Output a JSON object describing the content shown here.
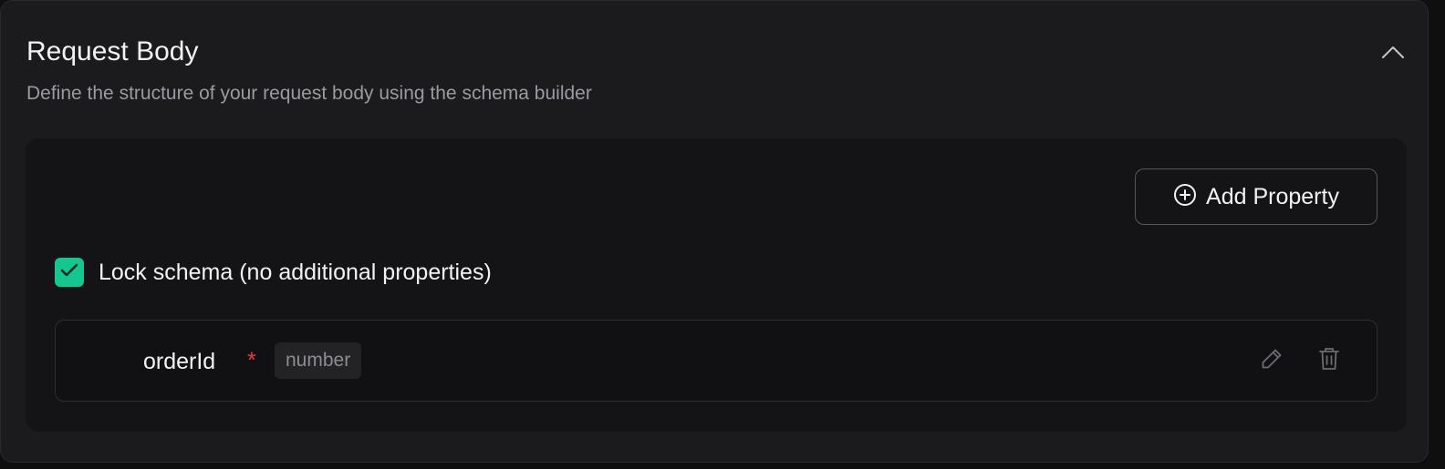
{
  "section": {
    "title": "Request Body",
    "subtitle": "Define the structure of your request body using the schema builder"
  },
  "toolbar": {
    "add_property_label": "Add Property"
  },
  "lock_schema": {
    "label": "Lock schema (no additional properties)",
    "checked": true
  },
  "properties": [
    {
      "name": "orderId",
      "required_marker": "*",
      "type": "number"
    }
  ],
  "icons": {
    "collapse": "chevron-up-icon",
    "add": "plus-circle-icon",
    "check": "check-icon",
    "edit": "pencil-icon",
    "delete": "trash-icon"
  },
  "colors": {
    "accent": "#14c68f",
    "required": "#e53e3e",
    "background": "#1b1b1d"
  }
}
